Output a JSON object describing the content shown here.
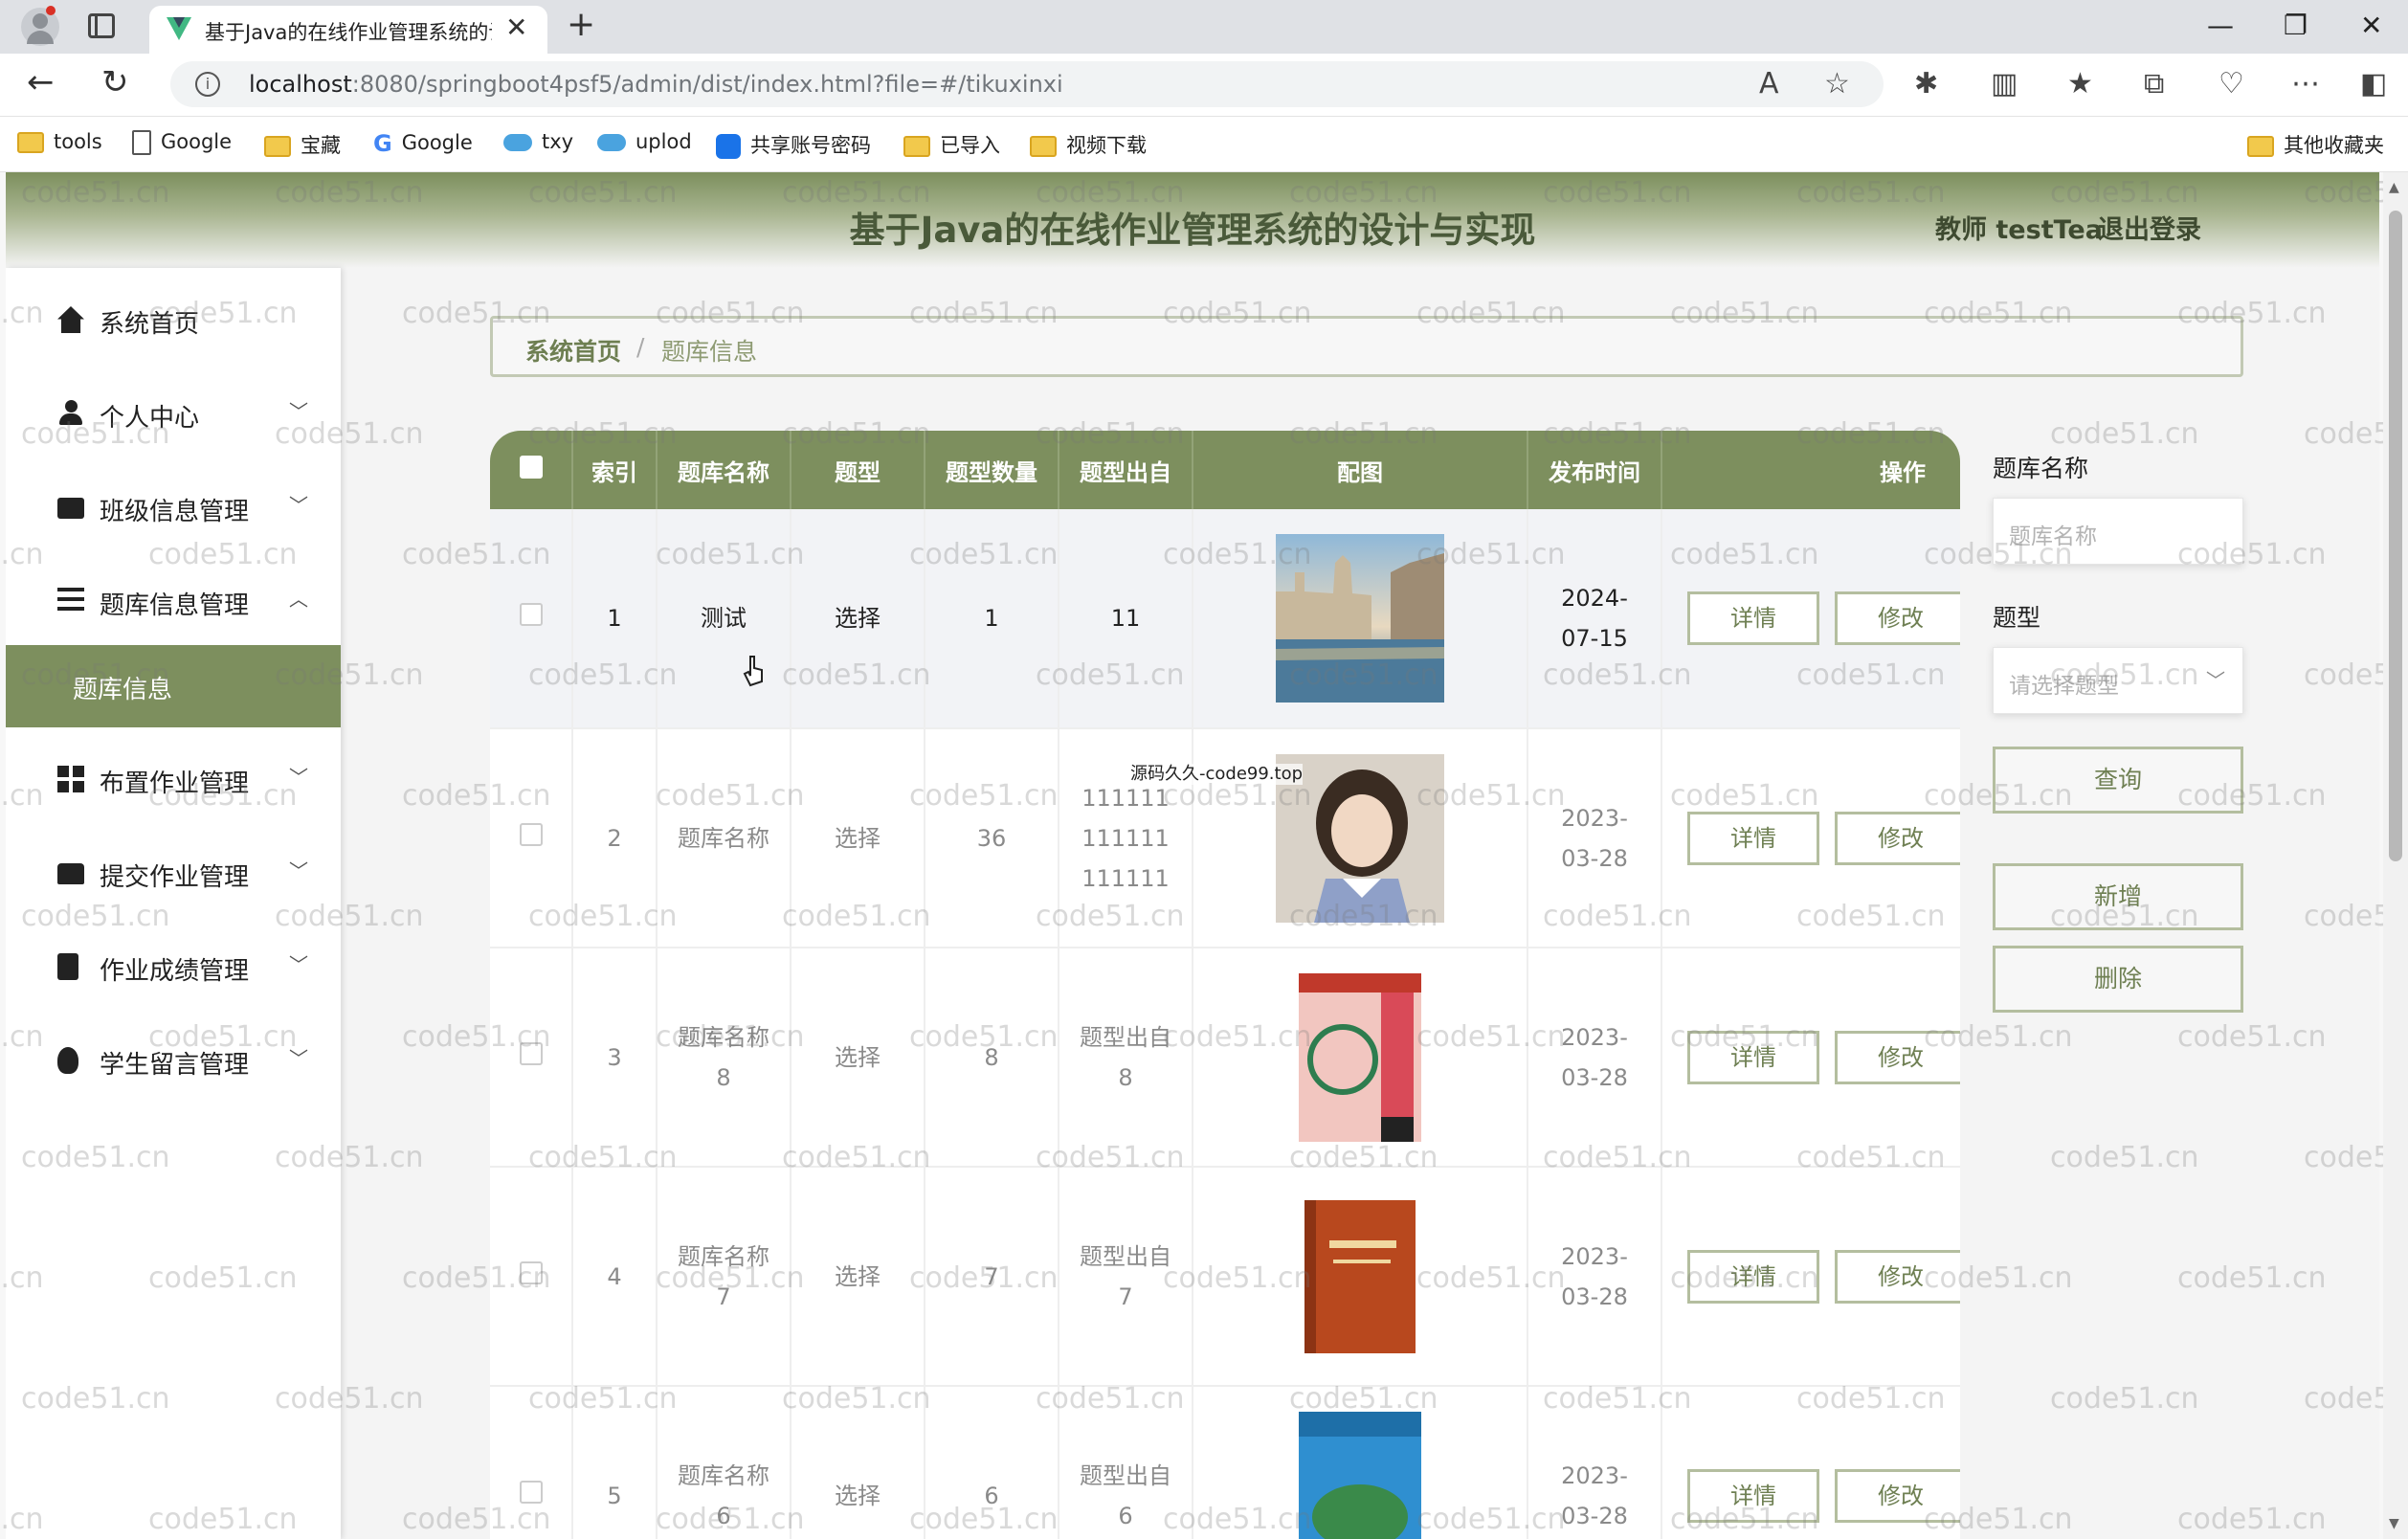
{
  "browser": {
    "tab_title": "基于Java的在线作业管理系统的设计与实现",
    "url_host": "localhost",
    "url_rest": ":8080/springboot4psf5/admin/dist/index.html?file=#/tikuxinxi",
    "bookmarks": [
      "tools",
      "Google",
      "宝藏",
      "Google",
      "txy",
      "uplod",
      "共享账号密码",
      "已导入",
      "视频下载"
    ],
    "other_bookmarks": "其他收藏夹"
  },
  "header": {
    "title": "基于Java的在线作业管理系统的设计与实现",
    "user": "教师 testTea",
    "logout": "退出登录"
  },
  "sidebar": {
    "items": [
      {
        "label": "系统首页",
        "icon": "home-icon"
      },
      {
        "label": "个人中心",
        "icon": "user-icon"
      },
      {
        "label": "班级信息管理",
        "icon": "wallet-icon"
      },
      {
        "label": "题库信息管理",
        "icon": "list-icon"
      },
      {
        "label": "布置作业管理",
        "icon": "grid-icon"
      },
      {
        "label": "提交作业管理",
        "icon": "inbox-icon"
      },
      {
        "label": "作业成绩管理",
        "icon": "clipboard-icon"
      },
      {
        "label": "学生留言管理",
        "icon": "bulb-icon"
      }
    ],
    "active_sub": "题库信息"
  },
  "breadcrumb": {
    "home": "系统首页",
    "separator": "/",
    "current": "题库信息"
  },
  "table": {
    "headers": [
      "索引",
      "题库名称",
      "题型",
      "题型数量",
      "题型出自",
      "配图",
      "发布时间",
      "操作"
    ],
    "detail_label": "详情",
    "edit_label": "修改",
    "rows": [
      {
        "index": "1",
        "name": "测试",
        "type": "选择",
        "count": "1",
        "source": "11",
        "time": "2024-07-15",
        "image": "venice-canal-photo"
      },
      {
        "index": "2",
        "name": "题库名称",
        "type": "选择",
        "count": "36",
        "source": "111111111111111111",
        "time": "2023-03-28",
        "image": "girl-portrait-photo",
        "overlay": "源码久久-code99.top"
      },
      {
        "index": "3",
        "name": "题库名称8",
        "type": "选择",
        "count": "8",
        "source": "题型出自8",
        "time": "2023-03-28",
        "image": "college-english-book-cover"
      },
      {
        "index": "4",
        "name": "题库名称7",
        "type": "选择",
        "count": "7",
        "source": "题型出自7",
        "time": "2023-03-28",
        "image": "literature-book-cover"
      },
      {
        "index": "5",
        "name": "题库名称6",
        "type": "选择",
        "count": "6",
        "source": "题型出自6",
        "time": "2023-03-28",
        "image": "hydrology-book-cover"
      }
    ]
  },
  "search": {
    "name_label": "题库名称",
    "name_placeholder": "题库名称",
    "type_label": "题型",
    "type_placeholder": "请选择题型",
    "query_button": "查询",
    "add_button": "新增",
    "delete_button": "删除"
  },
  "watermark": "code51.cn",
  "colors": {
    "theme": "#7d8f5e",
    "theme_text": "#6e7f52",
    "header_text": "#4a5a3a"
  }
}
